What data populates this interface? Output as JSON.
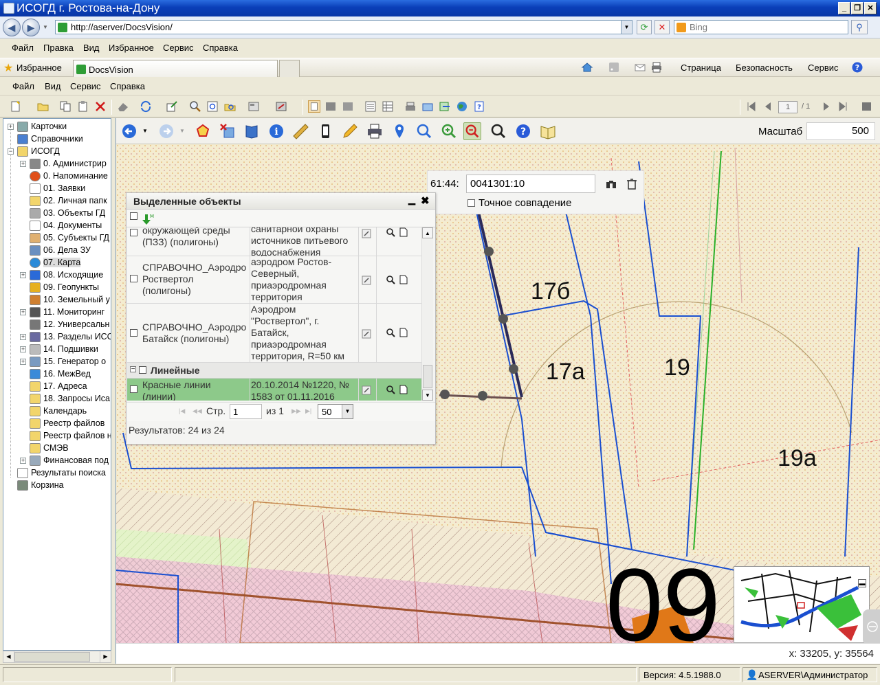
{
  "window": {
    "title": "ИСОГД г. Ростова-на-Дону",
    "buttons": {
      "minimize": "_",
      "restore": "❐",
      "close": "✕"
    }
  },
  "browser": {
    "url": "http://aserver/DocsVision/",
    "search_placeholder": "Bing",
    "menu": [
      "Файл",
      "Правка",
      "Вид",
      "Избранное",
      "Сервис",
      "Справка"
    ],
    "favorites_label": "Избранное",
    "tab_label": "DocsVision",
    "command_bar": [
      "Страница",
      "Безопасность",
      "Сервис"
    ]
  },
  "app": {
    "menu": [
      "Файл",
      "Вид",
      "Сервис",
      "Справка"
    ],
    "pager": {
      "current": "1",
      "total": "/ 1"
    }
  },
  "tree": {
    "items": [
      {
        "label": "Карточки",
        "level": 0,
        "expander": "+",
        "icon": "cards-icon"
      },
      {
        "label": "Справочники",
        "level": 0,
        "expander": "",
        "icon": "book-icon"
      },
      {
        "label": "ИСОГД",
        "level": 0,
        "expander": "−",
        "icon": "folder-icon"
      },
      {
        "label": "0. Администрир",
        "level": 1,
        "expander": "+",
        "icon": "tools-icon"
      },
      {
        "label": "0. Напоминание",
        "level": 1,
        "expander": "",
        "icon": "alarm-icon"
      },
      {
        "label": "01. Заявки",
        "level": 1,
        "expander": "",
        "icon": "document-icon"
      },
      {
        "label": "02. Личная папк",
        "level": 1,
        "expander": "",
        "icon": "folder-icon"
      },
      {
        "label": "03. Объекты ГД",
        "level": 1,
        "expander": "",
        "icon": "grid-icon"
      },
      {
        "label": "04. Документы",
        "level": 1,
        "expander": "",
        "icon": "document-icon"
      },
      {
        "label": "05. Субъекты ГД",
        "level": 1,
        "expander": "",
        "icon": "person-icon"
      },
      {
        "label": "06. Дела ЗУ",
        "level": 1,
        "expander": "",
        "icon": "case-icon"
      },
      {
        "label": "07. Карта",
        "level": 1,
        "expander": "",
        "icon": "globe-icon",
        "selected": true
      },
      {
        "label": "08. Исходящие",
        "level": 1,
        "expander": "+",
        "icon": "arrow-icon"
      },
      {
        "label": "09. Геопункты",
        "level": 1,
        "expander": "",
        "icon": "geopoint-icon"
      },
      {
        "label": "10. Земельный у",
        "level": 1,
        "expander": "",
        "icon": "land-icon"
      },
      {
        "label": "11. Мониторинг",
        "level": 1,
        "expander": "+",
        "icon": "eye-icon"
      },
      {
        "label": "12. Универсальн",
        "level": 1,
        "expander": "",
        "icon": "magnifier-icon"
      },
      {
        "label": "13. Разделы ИСС",
        "level": 1,
        "expander": "+",
        "icon": "sections-icon"
      },
      {
        "label": "14. Подшивки",
        "level": 1,
        "expander": "+",
        "icon": "binder-icon"
      },
      {
        "label": "15. Генератор о",
        "level": 1,
        "expander": "+",
        "icon": "generator-icon"
      },
      {
        "label": "16. МежВед",
        "level": 1,
        "expander": "",
        "icon": "exchange-icon"
      },
      {
        "label": "17. Адреса",
        "level": 1,
        "expander": "",
        "icon": "folder-icon"
      },
      {
        "label": "18. Запросы Иса",
        "level": 1,
        "expander": "",
        "icon": "folder-icon"
      },
      {
        "label": "Календарь",
        "level": 1,
        "expander": "",
        "icon": "folder-icon"
      },
      {
        "label": "Реестр файлов",
        "level": 1,
        "expander": "",
        "icon": "folder-icon"
      },
      {
        "label": "Реестр файлов н",
        "level": 1,
        "expander": "",
        "icon": "folder-icon"
      },
      {
        "label": "СМЭВ",
        "level": 1,
        "expander": "",
        "icon": "folder-icon"
      },
      {
        "label": "Финансовая под",
        "level": 1,
        "expander": "+",
        "icon": "finance-icon"
      },
      {
        "label": "Результаты поиска",
        "level": 0,
        "expander": "",
        "icon": "search-results-icon"
      },
      {
        "label": "Корзина",
        "level": 0,
        "expander": "",
        "icon": "trash-icon"
      }
    ]
  },
  "map": {
    "scale_label": "Масштаб",
    "scale_value": "500",
    "coords": "x: 33205, y: 35564",
    "labels": [
      "17б",
      "17а",
      "19",
      "19а",
      "09"
    ],
    "find": {
      "prefix": "61:44:",
      "value": "0041301:10",
      "exact_label": "Точное совпадение"
    }
  },
  "selected_panel": {
    "title": "Выделенные объекты",
    "rows": [
      {
        "c1": "окружающей среды\n(ПЗЗ) (полигоны)",
        "c2": "санитарной охраны\nисточников питьевого\nводоснабжения"
      },
      {
        "c1": "СПРАВОЧНО_Аэродро\nРоствертол\n(полигоны)",
        "c2": "аэродром Ростов-\nСеверный,\nприаэродромная\nтерритория"
      },
      {
        "c1": "СПРАВОЧНО_Аэродро\nБатайск (полигоны)",
        "c2": "Аэродром\n\"Роствертол\", г.\nБатайск,\nприаэродромная\nтерритория, R=50 км"
      }
    ],
    "group_label": "Линейные",
    "green_row": {
      "c1": "Красные линии\n(линии)",
      "c2": "20.10.2014 №1220, №\n1583 от 01.11.2016"
    },
    "pager": {
      "page_label": "Стр.",
      "page": "1",
      "of_label": "из 1",
      "page_size": "50"
    },
    "results": "Результатов: 24 из 24"
  },
  "status": {
    "version": "Версия: 4.5.1988.0",
    "user": "ASERVER\\Администратор"
  }
}
